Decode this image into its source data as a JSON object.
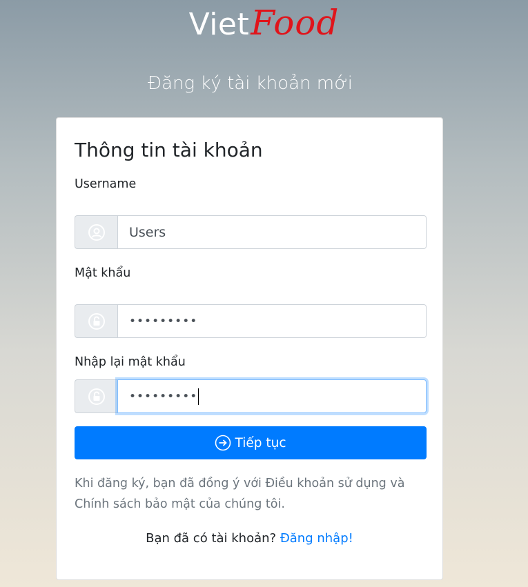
{
  "brand": {
    "part1": "Viet",
    "part2": "Food",
    "part2_color": "#e0141b"
  },
  "page_subtitle": "Đăng ký tài khoản mới",
  "card": {
    "title": "Thông tin tài khoản",
    "fields": [
      {
        "label": "Username",
        "icon": "user-circle-icon",
        "value": "Users"
      },
      {
        "label": "Mật khẩu",
        "icon": "lock-icon",
        "value": "•••••••••"
      },
      {
        "label": "Nhập lại mật khẩu",
        "icon": "lock-icon",
        "value": "•••••••••",
        "focused": true
      }
    ],
    "submit_button": {
      "label": "Tiếp tục",
      "icon": "arrow-right-circle-icon"
    },
    "terms_text": "Khi đăng ký, bạn đã đồng ý với Điều khoản sử dụng và Chính sách bảo mật của chúng tôi.",
    "login_prompt": "Bạn đã có tài khoản?",
    "login_link": "Đăng nhập!"
  },
  "colors": {
    "primary": "#007bff",
    "input_addon_bg": "#e9ecef",
    "muted_text": "#6c757d",
    "focus_border": "#80bdff"
  }
}
